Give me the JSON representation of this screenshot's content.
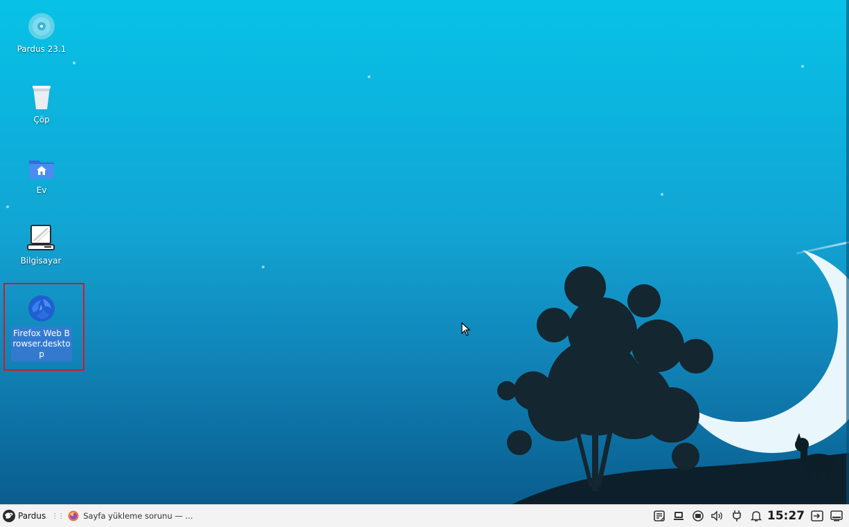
{
  "desktop": {
    "icons": [
      {
        "label": "Pardus 23.1",
        "icon": "disc-icon"
      },
      {
        "label": "Çöp",
        "icon": "trash-icon"
      },
      {
        "label": "Ev",
        "icon": "home-folder-icon"
      },
      {
        "label": "Bilgisayar",
        "icon": "computer-icon"
      },
      {
        "label": "Firefox Web Browser.desktop",
        "icon": "firefox-icon"
      }
    ],
    "selected_icon": "Firefox Web Browser.desktop",
    "highlight_color": "#e0141c",
    "wallpaper_colors": [
      "#08c2e6",
      "#0a5d8e"
    ]
  },
  "taskbar": {
    "menu_label": "Pardus",
    "task_title": "Sayfa yükleme sorunu — ...",
    "clock": "15:27",
    "tray_icons": [
      "notes-icon",
      "window-switcher-icon",
      "network-icon",
      "volume-icon",
      "power-plug-icon",
      "bell-icon",
      "logout-icon",
      "show-desktop-icon"
    ]
  }
}
